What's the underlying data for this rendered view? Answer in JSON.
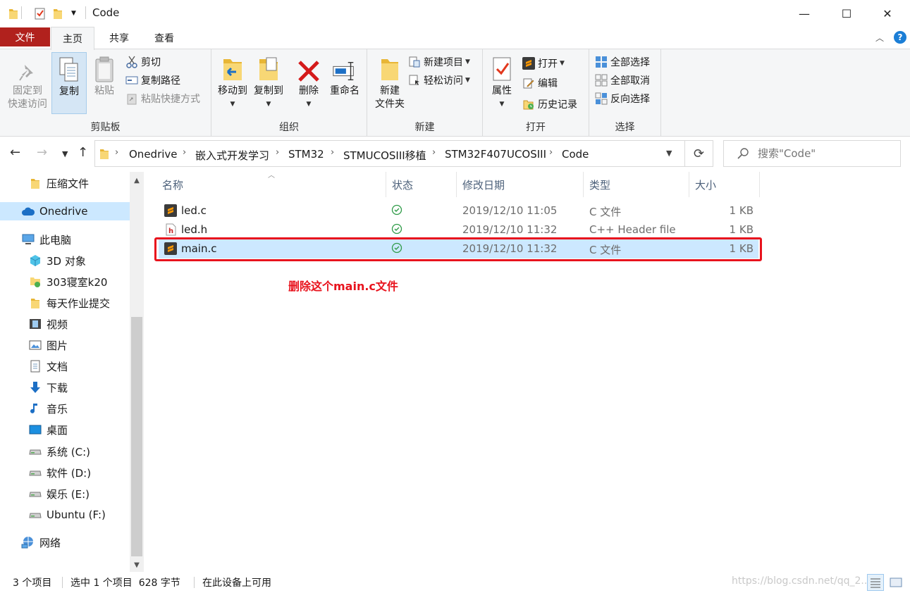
{
  "window": {
    "title": "Code",
    "minimize": "—",
    "maximize": "☐",
    "close": "✕"
  },
  "tabs": {
    "file": "文件",
    "home": "主页",
    "share": "共享",
    "view": "查看"
  },
  "ribbon": {
    "clipboard": {
      "label": "剪贴板",
      "pin": "固定到\n快速访问",
      "copy": "复制",
      "paste": "粘贴",
      "cut": "剪切",
      "copy_path": "复制路径",
      "paste_shortcut": "粘贴快捷方式"
    },
    "organize": {
      "label": "组织",
      "move_to": "移动到",
      "copy_to": "复制到",
      "delete": "删除",
      "rename": "重命名"
    },
    "new": {
      "label": "新建",
      "new_folder": "新建\n文件夹",
      "new_item": "新建项目",
      "easy_access": "轻松访问"
    },
    "open": {
      "label": "打开",
      "properties": "属性",
      "open": "打开",
      "edit": "编辑",
      "history": "历史记录"
    },
    "select": {
      "label": "选择",
      "select_all": "全部选择",
      "select_none": "全部取消",
      "invert": "反向选择"
    }
  },
  "address": {
    "crumbs": [
      "Onedrive",
      "嵌入式开发学习",
      "STM32",
      "STMUCOSIII移植",
      "STM32F407UCOSIII",
      "Code"
    ],
    "search_placeholder": "搜索\"Code\""
  },
  "nav": {
    "items": [
      {
        "label": "压缩文件",
        "icon": "folder-icon"
      },
      {
        "label": "Onedrive",
        "icon": "cloud-icon"
      },
      {
        "label": "此电脑",
        "icon": "computer-icon"
      },
      {
        "label": "3D 对象",
        "icon": "3d-objects-icon"
      },
      {
        "label": "303寝室k20",
        "icon": "network-pc-icon"
      },
      {
        "label": "每天作业提交",
        "icon": "folder-icon"
      },
      {
        "label": "视频",
        "icon": "video-icon"
      },
      {
        "label": "图片",
        "icon": "pictures-icon"
      },
      {
        "label": "文档",
        "icon": "documents-icon"
      },
      {
        "label": "下载",
        "icon": "download-icon"
      },
      {
        "label": "音乐",
        "icon": "music-icon"
      },
      {
        "label": "桌面",
        "icon": "desktop-icon"
      },
      {
        "label": "系统 (C:)",
        "icon": "drive-icon"
      },
      {
        "label": "软件 (D:)",
        "icon": "drive-icon"
      },
      {
        "label": "娱乐 (E:)",
        "icon": "drive-icon"
      },
      {
        "label": "Ubuntu (F:)",
        "icon": "drive-icon"
      },
      {
        "label": "网络",
        "icon": "network-icon"
      }
    ]
  },
  "columns": {
    "name": "名称",
    "status": "状态",
    "modified": "修改日期",
    "type": "类型",
    "size": "大小"
  },
  "files": [
    {
      "name": "led.c",
      "modified": "2019/12/10 11:05",
      "type": "C 文件",
      "size": "1 KB",
      "icon": "sublime-file-icon"
    },
    {
      "name": "led.h",
      "modified": "2019/12/10 11:32",
      "type": "C++ Header file",
      "size": "1 KB",
      "icon": "header-file-icon"
    },
    {
      "name": "main.c",
      "modified": "2019/12/10 11:32",
      "type": "C 文件",
      "size": "1 KB",
      "icon": "sublime-file-icon"
    }
  ],
  "annotation": "删除这个main.c文件",
  "status": {
    "count": "3 个项目",
    "selection": "选中 1 个项目  628 字节",
    "availability": "在此设备上可用",
    "watermark": "https://blog.csdn.net/qq_2..."
  },
  "colors": {
    "accent": "#b1211d",
    "selection": "#cce8ff",
    "annotation": "#e8131d",
    "sync_ok": "#2f9b48"
  }
}
